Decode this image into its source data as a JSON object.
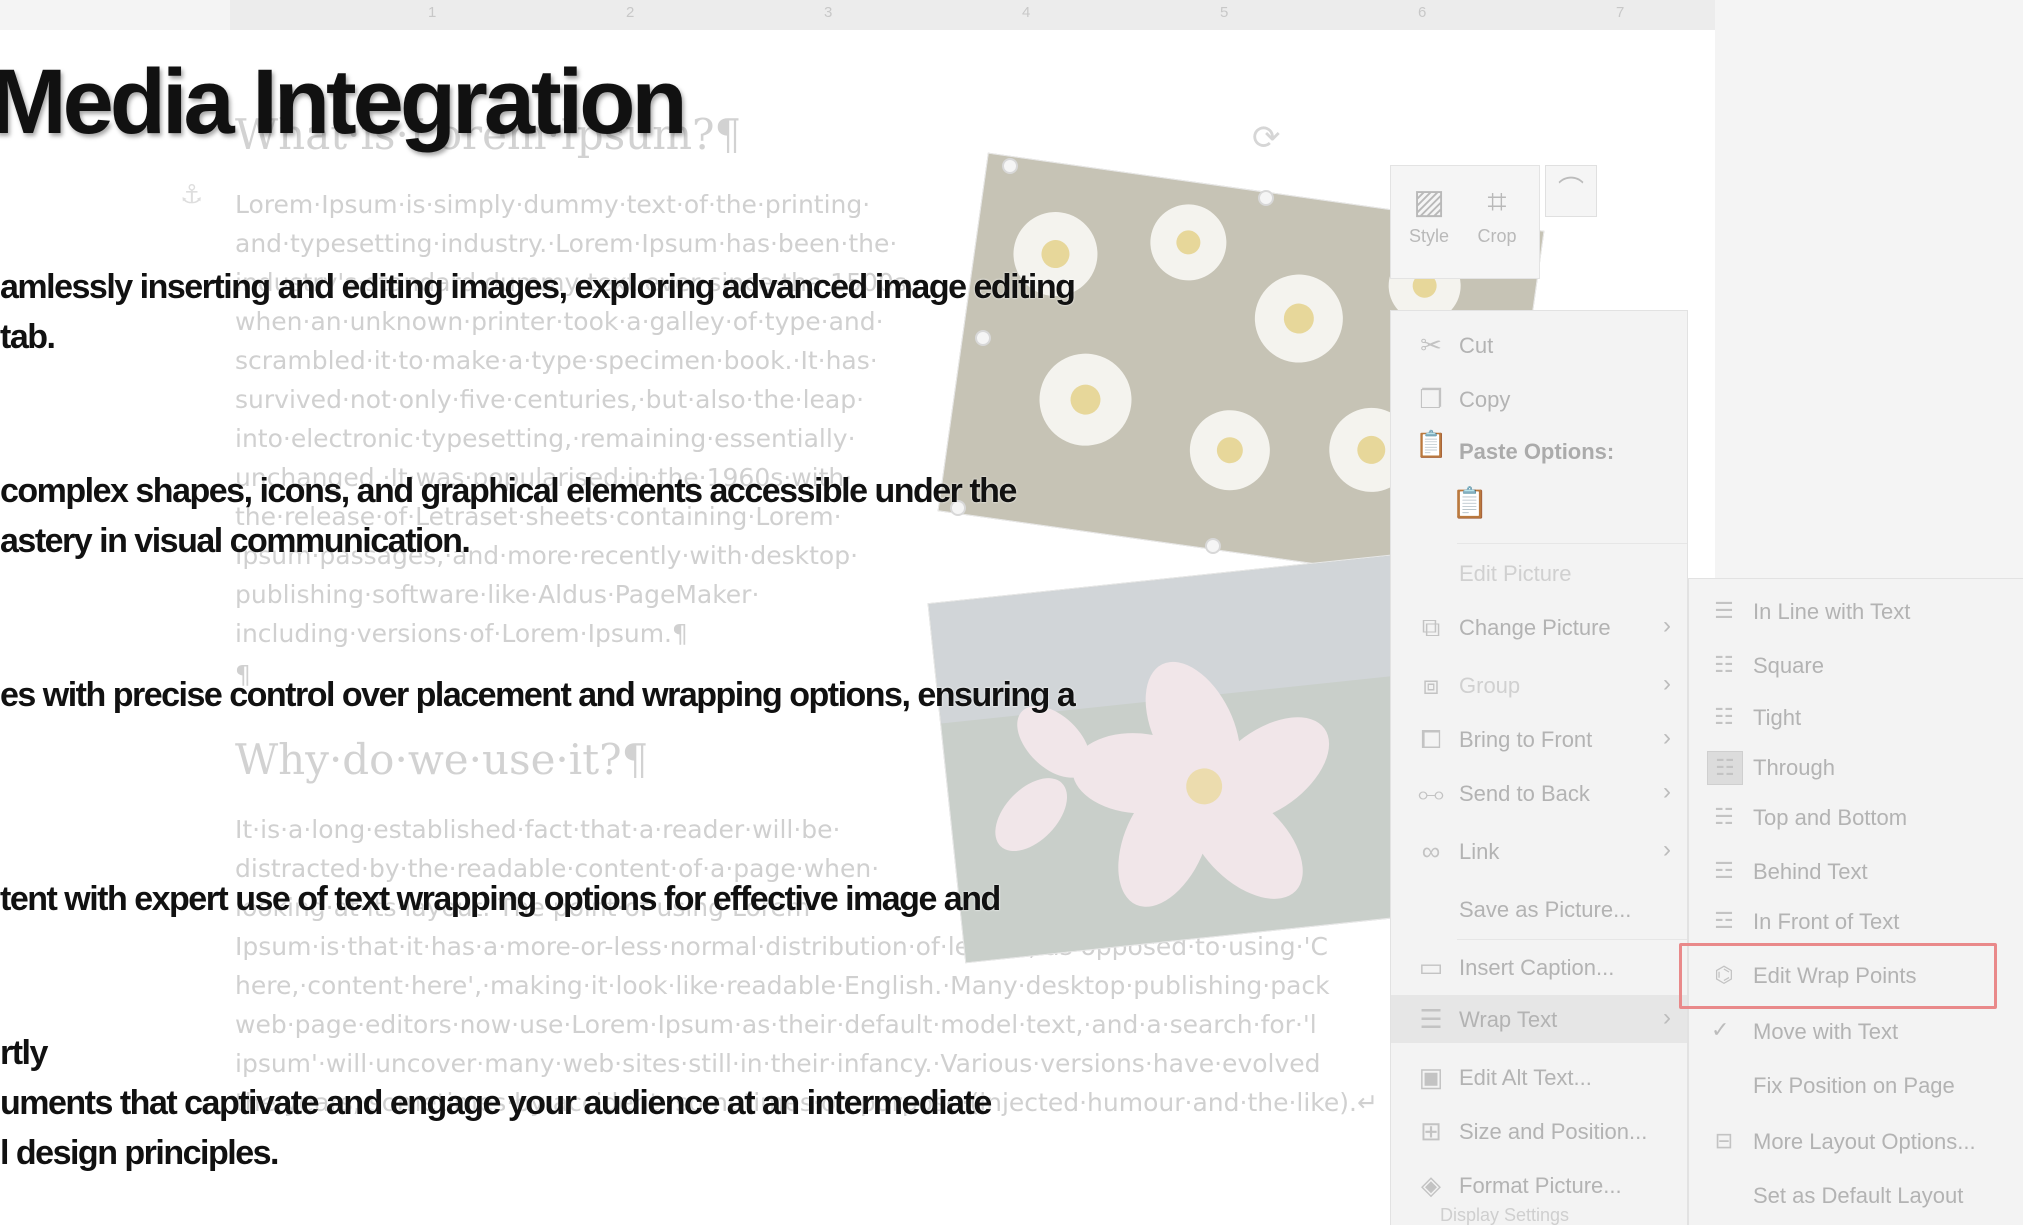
{
  "ruler": {
    "numbers": [
      "1",
      "2",
      "3",
      "4",
      "5",
      "6",
      "7"
    ]
  },
  "document": {
    "heading1": "What·is·Lorem·Ipsum?¶",
    "para1": [
      "Lorem·Ipsum·is·simply·dummy·text·of·the·printing·",
      "and·typesetting·industry.·Lorem·Ipsum·has·been·the·",
      "industry's·standard·dummy·text·ever·since·the·1500s,·",
      "when·an·unknown·printer·took·a·galley·of·type·and·",
      "scrambled·it·to·make·a·type·specimen·book.·It·has·",
      "survived·not·only·five·centuries,·but·also·the·leap·",
      "into·electronic·typesetting,·remaining·essentially·",
      "unchanged.·It·was·popularised·in·the·1960s·with·",
      "the·release·of·Letraset·sheets·containing·Lorem·",
      "Ipsum·passages,·and·more·recently·with·desktop·",
      "publishing·software·like·Aldus·PageMaker·",
      "including·versions·of·Lorem·Ipsum.¶"
    ],
    "pilcrow": "¶",
    "heading2": "Why·do·we·use·it?¶",
    "para2": [
      "It·is·a·long·established·fact·that·a·reader·will·be·",
      "distracted·by·the·readable·content·of·a·page·when·",
      "looking·at·its·layout.·The·point·of·using·Lorem·",
      "Ipsum·is·that·it·has·a·more-or-less·normal·distribution·of·letters,·as·opposed·to·using·'C",
      "here,·content·here',·making·it·look·like·readable·English.·Many·desktop·publishing·pack",
      "web·page·editors·now·use·Lorem·Ipsum·as·their·default·model·text,·and·a·search·for·'l",
      "ipsum'·will·uncover·many·web·sites·still·in·their·infancy.·Various·versions·have·evolved",
      "the·years,·sometimes·by·accident,·sometimes·on·purpose·(injected·humour·and·the·like).↵"
    ]
  },
  "overlay": {
    "title": "Media Integration",
    "bullets": [
      "amlessly inserting and editing images, exploring advanced image editing",
      "tab.",
      "complex shapes, icons, and graphical elements accessible under the",
      "astery in visual communication.",
      "es with precise control over placement and wrapping options, ensuring a",
      "tent with expert use of text wrapping options for effective image and",
      "rtly",
      "uments that captivate and engage your audience at an intermediate",
      "l design principles."
    ]
  },
  "mini_toolbar": {
    "style_label": "Style",
    "crop_label": "Crop"
  },
  "context_menu": {
    "cut": "Cut",
    "copy": "Copy",
    "paste_options": "Paste Options:",
    "edit_picture": "Edit Picture",
    "change_picture": "Change Picture",
    "group": "Group",
    "bring_to_front": "Bring to Front",
    "send_to_back": "Send to Back",
    "link": "Link",
    "save_as_picture": "Save as Picture...",
    "insert_caption": "Insert Caption...",
    "wrap_text": "Wrap Text",
    "edit_alt_text": "Edit Alt Text...",
    "size_and_position": "Size and Position...",
    "format_picture": "Format Picture..."
  },
  "wrap_submenu": {
    "in_line": "In Line with Text",
    "square": "Square",
    "tight": "Tight",
    "through": "Through",
    "top_bottom": "Top and Bottom",
    "behind": "Behind Text",
    "in_front": "In Front of Text",
    "edit_wrap_points": "Edit Wrap Points",
    "move_with_text": "Move with Text",
    "fix_position": "Fix Position on Page",
    "more_layout": "More Layout Options...",
    "set_default": "Set as Default Layout"
  },
  "footer": {
    "display_settings": "Display Settings"
  },
  "colors": {
    "highlight_border": "#e9898a",
    "headline": "#111111",
    "menu_bg": "#f3f3f3"
  }
}
